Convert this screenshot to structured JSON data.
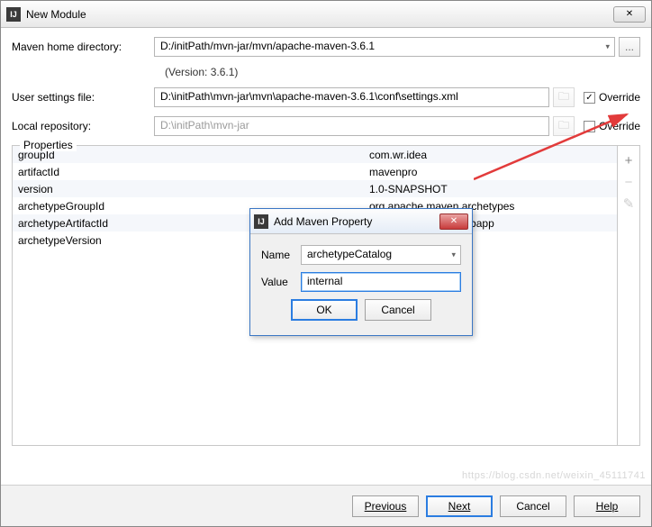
{
  "window": {
    "title": "New Module",
    "close_glyph": "✕"
  },
  "fields": {
    "maven_home_label": "Maven home directory:",
    "maven_home_value": "D:/initPath/mvn-jar/mvn/apache-maven-3.6.1",
    "version_text": "(Version: 3.6.1)",
    "user_settings_label": "User settings file:",
    "user_settings_value": "D:\\initPath\\mvn-jar\\mvn\\apache-maven-3.6.1\\conf\\settings.xml",
    "local_repo_label": "Local repository:",
    "local_repo_value": "D:\\initPath\\mvn-jar",
    "override_label": "Override",
    "ellipsis": "...",
    "user_override_checked": "✓",
    "local_override_checked": ""
  },
  "properties": {
    "title": "Properties",
    "rows": [
      {
        "k": "groupId",
        "v": "com.wr.idea"
      },
      {
        "k": "artifactId",
        "v": "mavenpro"
      },
      {
        "k": "version",
        "v": "1.0-SNAPSHOT"
      },
      {
        "k": "archetypeGroupId",
        "v": "org.apache.maven.archetypes"
      },
      {
        "k": "archetypeArtifactId",
        "v": "maven-archetype-webapp"
      },
      {
        "k": "archetypeVersion",
        "v": ""
      }
    ],
    "add_glyph": "+",
    "remove_glyph": "−",
    "edit_glyph": "✎"
  },
  "modal": {
    "title": "Add Maven Property",
    "name_label": "Name",
    "value_label": "Value",
    "name_value": "archetypeCatalog",
    "value_value": "internal",
    "ok": "OK",
    "cancel": "Cancel",
    "close_glyph": "✕"
  },
  "footer": {
    "previous": "Previous",
    "next": "Next",
    "cancel": "Cancel",
    "help": "Help"
  },
  "watermark": "https://blog.csdn.net/weixin_45111741"
}
